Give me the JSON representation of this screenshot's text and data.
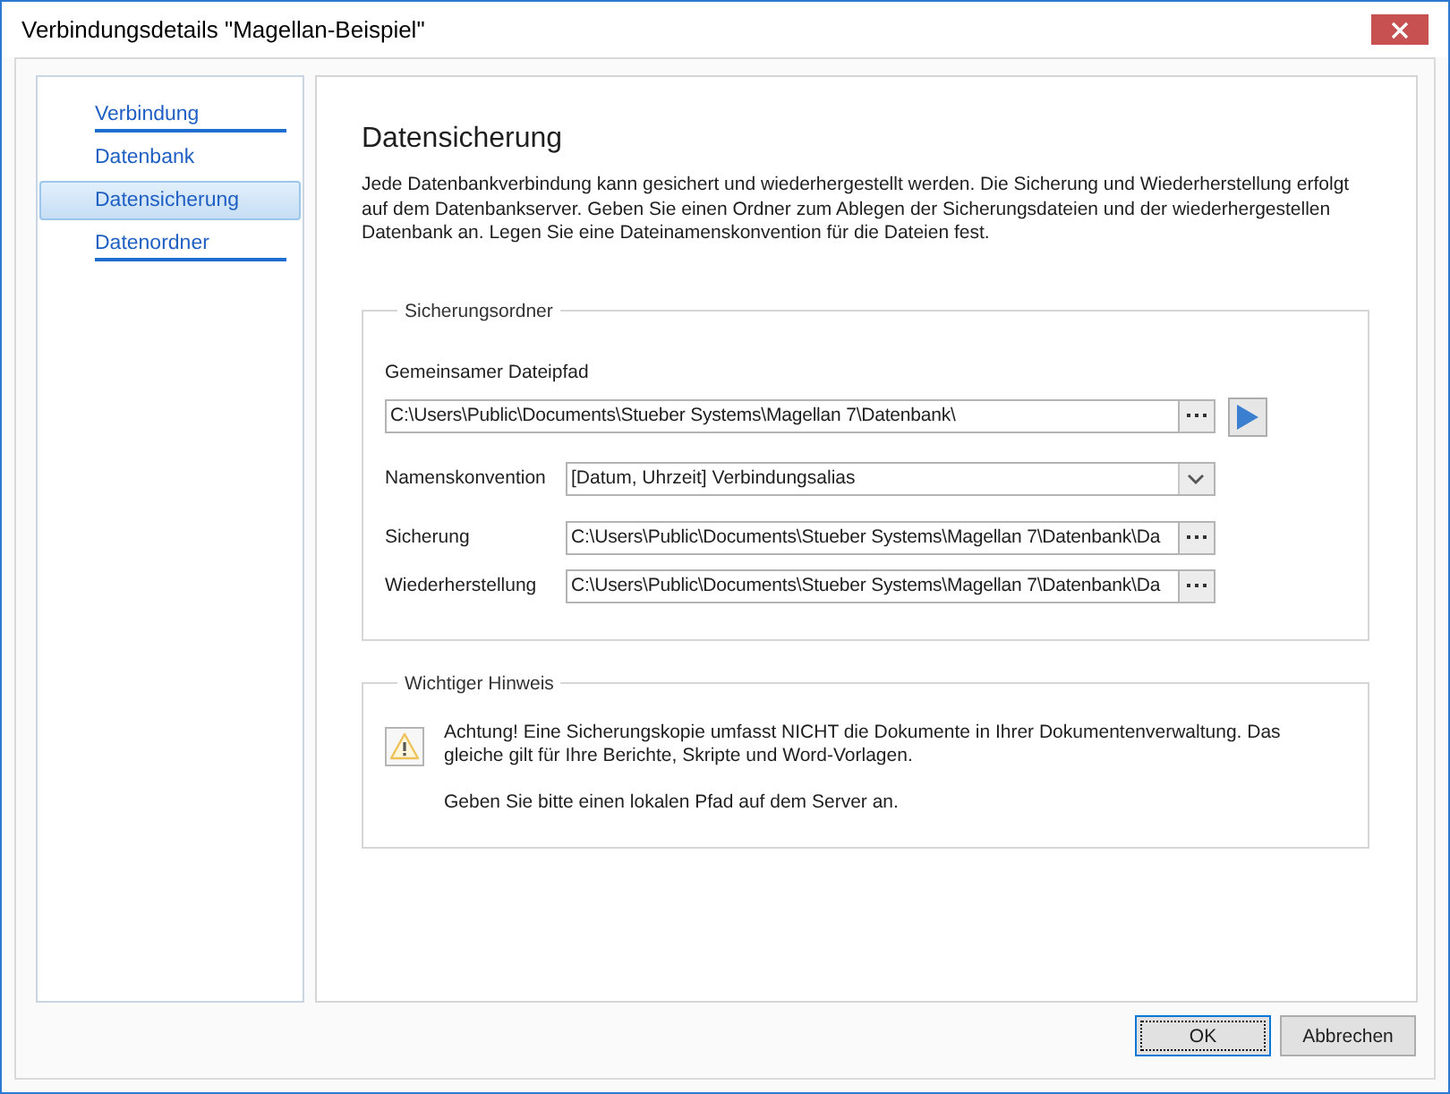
{
  "window": {
    "title": "Verbindungsdetails \"Magellan-Beispiel\""
  },
  "sidebar": {
    "items": [
      {
        "label": "Verbindung",
        "selected": false,
        "underlined": true
      },
      {
        "label": "Datenbank",
        "selected": false,
        "underlined": false
      },
      {
        "label": "Datensicherung",
        "selected": true,
        "underlined": false
      },
      {
        "label": "Datenordner",
        "selected": false,
        "underlined": true
      }
    ]
  },
  "page": {
    "heading": "Datensicherung",
    "description": "Jede Datenbankverbindung kann gesichert und wiederhergestellt werden. Die Sicherung und Wiederherstellung erfolgt auf dem Datenbankserver. Geben Sie einen Ordner zum Ablegen der Sicherungsdateien und der wiederhergestellen Datenbank an. Legen Sie eine Dateinamenskonvention für die Dateien fest."
  },
  "backup_folder": {
    "title": "Sicherungsordner",
    "shared_path": {
      "label": "Gemeinsamer Dateipfad",
      "value": "C:\\Users\\Public\\Documents\\Stueber Systems\\Magellan 7\\Datenbank\\"
    },
    "naming": {
      "label": "Namenskonvention",
      "value": "[Datum, Uhrzeit] Verbindungsalias"
    },
    "paths": [
      {
        "label": "Sicherung",
        "value": "C:\\Users\\Public\\Documents\\Stueber Systems\\Magellan 7\\Datenbank\\Da"
      },
      {
        "label": "Wiederherstellung",
        "value": "C:\\Users\\Public\\Documents\\Stueber Systems\\Magellan 7\\Datenbank\\Da"
      }
    ]
  },
  "notice": {
    "title": "Wichtiger Hinweis",
    "paragraphs": [
      "Achtung! Eine Sicherungskopie umfasst NICHT die Dokumente in Ihrer Dokumentenverwaltung. Das gleiche gilt für Ihre Berichte, Skripte und Word-Vorlagen.",
      "Geben Sie bitte einen lokalen Pfad auf dem Server an."
    ]
  },
  "buttons": [
    {
      "label": "OK",
      "focused": true
    },
    {
      "label": "Abbrechen",
      "focused": false
    }
  ]
}
